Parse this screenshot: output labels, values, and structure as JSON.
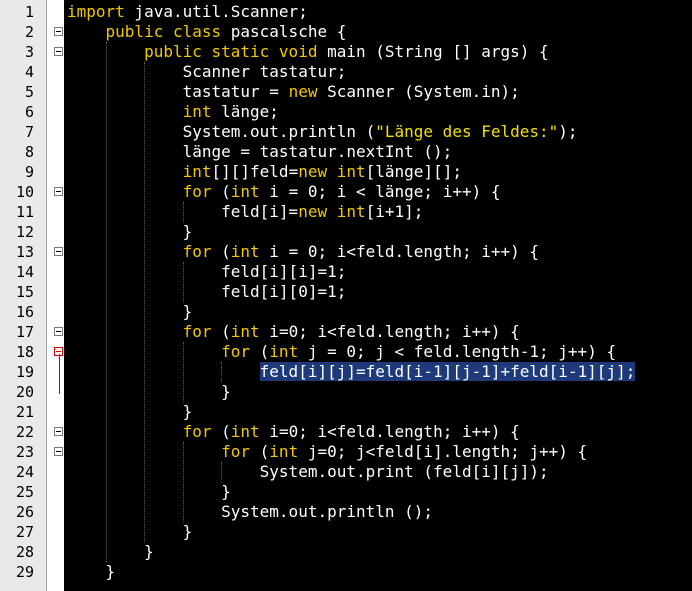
{
  "editor": {
    "lines": [
      {
        "n": "1",
        "segs": [
          [
            "kw",
            "import"
          ],
          [
            "t",
            " java.util.Scanner;"
          ]
        ]
      },
      {
        "n": "2",
        "segs": [
          [
            "t",
            "    "
          ],
          [
            "kw",
            "public class"
          ],
          [
            "t",
            " pascalsche {"
          ]
        ]
      },
      {
        "n": "3",
        "segs": [
          [
            "t",
            "        "
          ],
          [
            "kw",
            "public static void"
          ],
          [
            "t",
            " main (String [] args) {"
          ]
        ]
      },
      {
        "n": "4",
        "segs": [
          [
            "t",
            "            Scanner tastatur;"
          ]
        ]
      },
      {
        "n": "5",
        "segs": [
          [
            "t",
            "            tastatur = "
          ],
          [
            "kw",
            "new"
          ],
          [
            "t",
            " Scanner (System.in);"
          ]
        ]
      },
      {
        "n": "6",
        "segs": [
          [
            "t",
            "            "
          ],
          [
            "kw",
            "int"
          ],
          [
            "t",
            " länge;"
          ]
        ]
      },
      {
        "n": "7",
        "segs": [
          [
            "t",
            "            System.out.println ("
          ],
          [
            "str",
            "\"Länge des Feldes:\""
          ],
          [
            "t",
            ");"
          ]
        ]
      },
      {
        "n": "8",
        "segs": [
          [
            "t",
            "            länge = tastatur.nextInt ();"
          ]
        ]
      },
      {
        "n": "9",
        "segs": [
          [
            "t",
            "            "
          ],
          [
            "kw",
            "int"
          ],
          [
            "t",
            "[][]feld="
          ],
          [
            "kw",
            "new int"
          ],
          [
            "t",
            "[länge][];"
          ]
        ]
      },
      {
        "n": "10",
        "segs": [
          [
            "t",
            "            "
          ],
          [
            "kw",
            "for"
          ],
          [
            "t",
            " ("
          ],
          [
            "kw",
            "int"
          ],
          [
            "t",
            " i = 0; i < länge; i++) {"
          ]
        ]
      },
      {
        "n": "11",
        "segs": [
          [
            "t",
            "                feld[i]="
          ],
          [
            "kw",
            "new int"
          ],
          [
            "t",
            "[i+1];"
          ]
        ]
      },
      {
        "n": "12",
        "segs": [
          [
            "t",
            "            }"
          ]
        ]
      },
      {
        "n": "13",
        "segs": [
          [
            "t",
            "            "
          ],
          [
            "kw",
            "for"
          ],
          [
            "t",
            " ("
          ],
          [
            "kw",
            "int"
          ],
          [
            "t",
            " i = 0; i<feld.length; i++) {"
          ]
        ]
      },
      {
        "n": "14",
        "segs": [
          [
            "t",
            "                feld[i][i]=1;"
          ]
        ]
      },
      {
        "n": "15",
        "segs": [
          [
            "t",
            "                feld[i][0]=1;"
          ]
        ]
      },
      {
        "n": "16",
        "segs": [
          [
            "t",
            "            }"
          ]
        ]
      },
      {
        "n": "17",
        "segs": [
          [
            "t",
            "            "
          ],
          [
            "kw",
            "for"
          ],
          [
            "t",
            " ("
          ],
          [
            "kw",
            "int"
          ],
          [
            "t",
            " i=0; i<feld.length; i++) {"
          ]
        ]
      },
      {
        "n": "18",
        "segs": [
          [
            "t",
            "                "
          ],
          [
            "kw",
            "for"
          ],
          [
            "t",
            " ("
          ],
          [
            "kw",
            "int"
          ],
          [
            "t",
            " j = 0; j < feld.length-1; j++) {"
          ]
        ]
      },
      {
        "n": "19",
        "segs": [
          [
            "t",
            "                    "
          ],
          [
            "hl",
            "feld[i][j]=feld[i-1][j-1]+feld[i-1][j];"
          ]
        ]
      },
      {
        "n": "20",
        "segs": [
          [
            "t",
            "                }"
          ]
        ]
      },
      {
        "n": "21",
        "segs": [
          [
            "t",
            "            }"
          ]
        ]
      },
      {
        "n": "22",
        "segs": [
          [
            "t",
            "            "
          ],
          [
            "kw",
            "for"
          ],
          [
            "t",
            " ("
          ],
          [
            "kw",
            "int"
          ],
          [
            "t",
            " i=0; i<feld.length; i++) {"
          ]
        ]
      },
      {
        "n": "23",
        "segs": [
          [
            "t",
            "                "
          ],
          [
            "kw",
            "for"
          ],
          [
            "t",
            " ("
          ],
          [
            "kw",
            "int"
          ],
          [
            "t",
            " j=0; j<feld[i].length; j++) {"
          ]
        ]
      },
      {
        "n": "24",
        "segs": [
          [
            "t",
            "                    System.out.print (feld[i][j]);"
          ]
        ]
      },
      {
        "n": "25",
        "segs": [
          [
            "t",
            "                }"
          ]
        ]
      },
      {
        "n": "26",
        "segs": [
          [
            "t",
            "                System.out.println ();"
          ]
        ]
      },
      {
        "n": "27",
        "segs": [
          [
            "t",
            "            }"
          ]
        ]
      },
      {
        "n": "28",
        "segs": [
          [
            "t",
            "        }"
          ]
        ]
      },
      {
        "n": "29",
        "segs": [
          [
            "t",
            "    }"
          ]
        ]
      }
    ],
    "fold_markers": [
      "2",
      "3",
      "10",
      "13",
      "17",
      "18",
      "22",
      "23"
    ],
    "active_fold": "18",
    "colors": {
      "background": "#000000",
      "keyword": "#f0c800",
      "string": "#f0e000",
      "text": "#ffffff",
      "selection": "#1f3a7a",
      "gutter": "#e9e9e9"
    }
  }
}
